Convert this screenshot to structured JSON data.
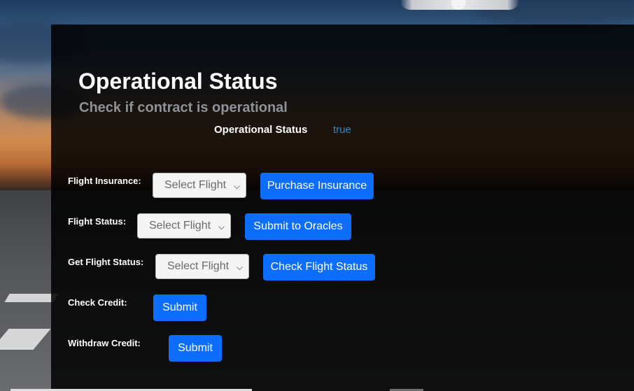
{
  "header": {
    "title": "Operational Status",
    "subtitle": "Check if contract is operational"
  },
  "operational": {
    "label": "Operational Status",
    "value": "true",
    "value_color": "#2c86c8"
  },
  "rows": {
    "insurance": {
      "label": "Flight Insurance:",
      "select": "Select Flight",
      "button": "Purchase Insurance"
    },
    "status": {
      "label": "Flight Status:",
      "select": "Select Flight",
      "button": "Submit to Oracles"
    },
    "get_status": {
      "label": "Get Flight Status:",
      "select": "Select Flight",
      "button": "Check Flight Status"
    },
    "credit": {
      "label": "Check Credit:",
      "button": "Submit"
    },
    "withdraw": {
      "label": "Withdraw Credit:",
      "button": "Submit"
    }
  },
  "colors": {
    "accent": "#0d6efd",
    "panel": "rgba(0,0,0,0.86)"
  },
  "icons": {
    "select_chevron": "chevron-down-icon"
  }
}
